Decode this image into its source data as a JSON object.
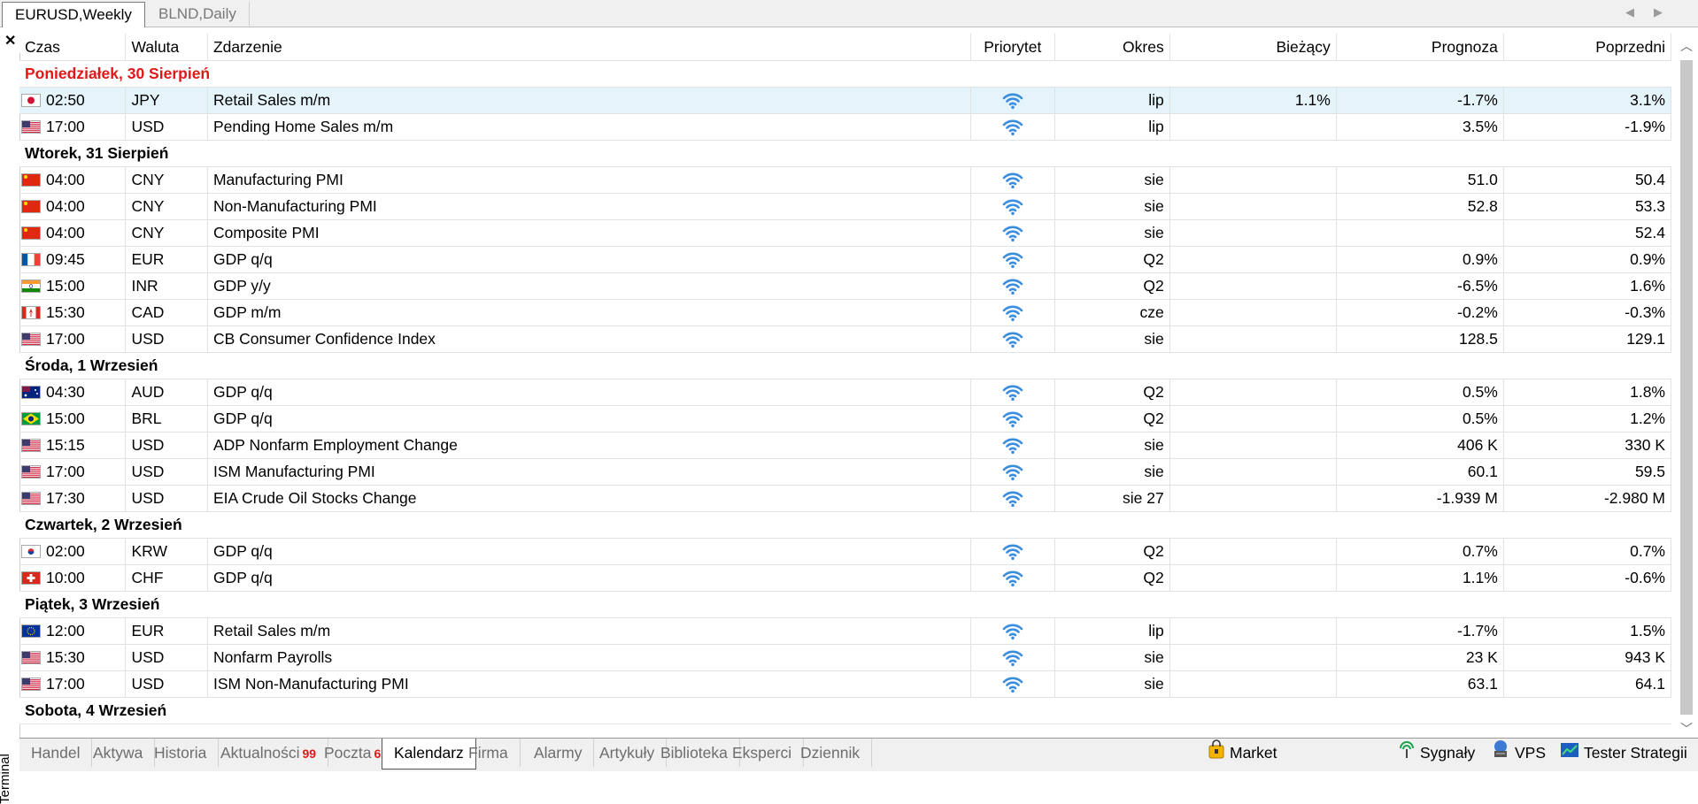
{
  "chart_tabs": [
    {
      "label": "EURUSD,Weekly"
    },
    {
      "label": "BLND,Daily"
    }
  ],
  "panel_label": "Terminal",
  "columns": {
    "time": "Czas",
    "currency": "Waluta",
    "event": "Zdarzenie",
    "priority": "Priorytet",
    "period": "Okres",
    "actual": "Bieżący",
    "forecast": "Prognoza",
    "previous": "Poprzedni"
  },
  "days": [
    {
      "label": "Poniedziałek, 30 Sierpień",
      "today": true,
      "events": [
        {
          "flag": "JP",
          "time": "02:50",
          "currency": "JPY",
          "event": "Retail Sales m/m",
          "period": "lip",
          "actual": "1.1%",
          "forecast": "-1.7%",
          "previous": "3.1%",
          "selected": true
        },
        {
          "flag": "US",
          "time": "17:00",
          "currency": "USD",
          "event": "Pending Home Sales m/m",
          "period": "lip",
          "actual": "",
          "forecast": "3.5%",
          "previous": "-1.9%"
        }
      ]
    },
    {
      "label": "Wtorek, 31 Sierpień",
      "events": [
        {
          "flag": "CN",
          "time": "04:00",
          "currency": "CNY",
          "event": "Manufacturing PMI",
          "period": "sie",
          "actual": "",
          "forecast": "51.0",
          "previous": "50.4"
        },
        {
          "flag": "CN",
          "time": "04:00",
          "currency": "CNY",
          "event": "Non-Manufacturing PMI",
          "period": "sie",
          "actual": "",
          "forecast": "52.8",
          "previous": "53.3"
        },
        {
          "flag": "CN",
          "time": "04:00",
          "currency": "CNY",
          "event": "Composite PMI",
          "period": "sie",
          "actual": "",
          "forecast": "",
          "previous": "52.4"
        },
        {
          "flag": "FR",
          "time": "09:45",
          "currency": "EUR",
          "event": "GDP q/q",
          "period": "Q2",
          "actual": "",
          "forecast": "0.9%",
          "previous": "0.9%"
        },
        {
          "flag": "IN",
          "time": "15:00",
          "currency": "INR",
          "event": "GDP y/y",
          "period": "Q2",
          "actual": "",
          "forecast": "-6.5%",
          "previous": "1.6%"
        },
        {
          "flag": "CA",
          "time": "15:30",
          "currency": "CAD",
          "event": "GDP m/m",
          "period": "cze",
          "actual": "",
          "forecast": "-0.2%",
          "previous": "-0.3%"
        },
        {
          "flag": "US",
          "time": "17:00",
          "currency": "USD",
          "event": "CB Consumer Confidence Index",
          "period": "sie",
          "actual": "",
          "forecast": "128.5",
          "previous": "129.1"
        }
      ]
    },
    {
      "label": "Środa, 1 Wrzesień",
      "events": [
        {
          "flag": "AU",
          "time": "04:30",
          "currency": "AUD",
          "event": "GDP q/q",
          "period": "Q2",
          "actual": "",
          "forecast": "0.5%",
          "previous": "1.8%"
        },
        {
          "flag": "BR",
          "time": "15:00",
          "currency": "BRL",
          "event": "GDP q/q",
          "period": "Q2",
          "actual": "",
          "forecast": "0.5%",
          "previous": "1.2%"
        },
        {
          "flag": "US",
          "time": "15:15",
          "currency": "USD",
          "event": "ADP Nonfarm Employment Change",
          "period": "sie",
          "actual": "",
          "forecast": "406 K",
          "previous": "330 K"
        },
        {
          "flag": "US",
          "time": "17:00",
          "currency": "USD",
          "event": "ISM Manufacturing PMI",
          "period": "sie",
          "actual": "",
          "forecast": "60.1",
          "previous": "59.5"
        },
        {
          "flag": "US",
          "time": "17:30",
          "currency": "USD",
          "event": "EIA Crude Oil Stocks Change",
          "period": "sie 27",
          "actual": "",
          "forecast": "-1.939 M",
          "previous": "-2.980 M"
        }
      ]
    },
    {
      "label": "Czwartek, 2 Wrzesień",
      "events": [
        {
          "flag": "KR",
          "time": "02:00",
          "currency": "KRW",
          "event": "GDP q/q",
          "period": "Q2",
          "actual": "",
          "forecast": "0.7%",
          "previous": "0.7%"
        },
        {
          "flag": "CH",
          "time": "10:00",
          "currency": "CHF",
          "event": "GDP q/q",
          "period": "Q2",
          "actual": "",
          "forecast": "1.1%",
          "previous": "-0.6%"
        }
      ]
    },
    {
      "label": "Piątek, 3 Wrzesień",
      "events": [
        {
          "flag": "EU",
          "time": "12:00",
          "currency": "EUR",
          "event": "Retail Sales m/m",
          "period": "lip",
          "actual": "",
          "forecast": "-1.7%",
          "previous": "1.5%"
        },
        {
          "flag": "US",
          "time": "15:30",
          "currency": "USD",
          "event": "Nonfarm Payrolls",
          "period": "sie",
          "actual": "",
          "forecast": "23 K",
          "previous": "943 K"
        },
        {
          "flag": "US",
          "time": "17:00",
          "currency": "USD",
          "event": "ISM Non-Manufacturing PMI",
          "period": "sie",
          "actual": "",
          "forecast": "63.1",
          "previous": "64.1"
        }
      ]
    },
    {
      "label": "Sobota, 4 Wrzesień",
      "events": []
    }
  ],
  "bottom_tabs": [
    {
      "label": "Handel"
    },
    {
      "label": "Aktywa"
    },
    {
      "label": "Historia"
    },
    {
      "label": "Aktualności",
      "badge": "99"
    },
    {
      "label": "Poczta",
      "badge": "6"
    },
    {
      "label": "Kalendarz",
      "active": true
    },
    {
      "label": "Firma"
    },
    {
      "label": "Alarmy"
    },
    {
      "label": "Artykuły"
    },
    {
      "label": "Biblioteka"
    },
    {
      "label": "Eksperci"
    },
    {
      "label": "Dziennik"
    }
  ],
  "right_buttons": [
    {
      "label": "Market",
      "icon": "market-bag-icon"
    },
    {
      "label": "Sygnały",
      "icon": "signals-icon"
    },
    {
      "label": "VPS",
      "icon": "vps-icon"
    },
    {
      "label": "Tester Strategii",
      "icon": "strategy-tester-icon"
    }
  ],
  "colors": {
    "today": "#e01818",
    "badge": "#e01818",
    "priority": "#3b8de0",
    "selected_row": "#e5f3fb"
  }
}
